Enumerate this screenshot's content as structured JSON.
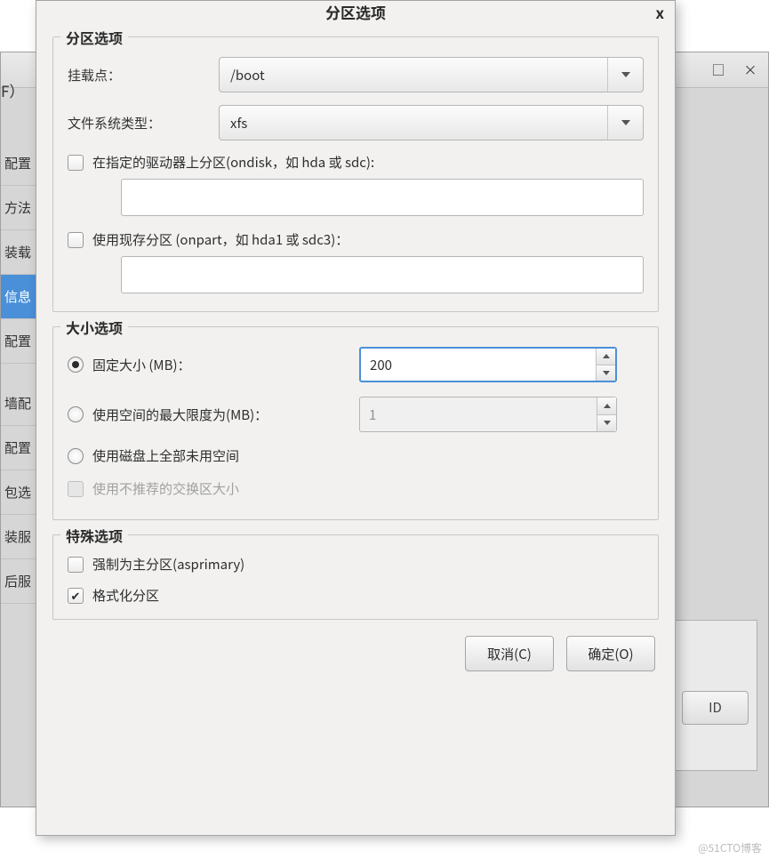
{
  "dialogTitle": "分区选项",
  "closeIcon": "x",
  "bgWindow": {
    "maxIcon": "□",
    "closeIcon": "×",
    "leftLabelF": "F）",
    "sidebar": [
      "配置",
      "方法",
      "装载",
      "信息",
      "配置",
      "墙配",
      "配置",
      "包选",
      "装服",
      "后服"
    ],
    "selectedIndex": 3,
    "bottomButton": "ID"
  },
  "partitionOptions": {
    "frameTitle": "分区选项",
    "mountPoint": {
      "label": "挂载点：",
      "value": "/boot"
    },
    "fsType": {
      "label": "文件系统类型：",
      "value": "xfs"
    },
    "ondisk": {
      "label": "在指定的驱动器上分区(ondisk，如 hda 或 sdc):",
      "checked": false,
      "value": ""
    },
    "onpart": {
      "label": "使用现存分区 (onpart，如 hda1 或 sdc3)：",
      "checked": false,
      "value": ""
    }
  },
  "sizeOptions": {
    "frameTitle": "大小选项",
    "fixed": {
      "label": "固定大小 (MB)：",
      "value": "200",
      "selected": true
    },
    "maxTo": {
      "label": "使用空间的最大限度为(MB)：",
      "value": "1",
      "selected": false
    },
    "allFree": {
      "label": "使用磁盘上全部未用空间",
      "selected": false
    },
    "swapRec": {
      "label": "使用不推荐的交换区大小",
      "enabled": false,
      "checked": false
    }
  },
  "specialOptions": {
    "frameTitle": "特殊选项",
    "asprimary": {
      "label": "强制为主分区(asprimary)",
      "checked": false
    },
    "format": {
      "label": "格式化分区",
      "checked": true
    }
  },
  "actions": {
    "cancel": "取消(C)",
    "ok": "确定(O)"
  },
  "watermark": "@51CTO博客"
}
